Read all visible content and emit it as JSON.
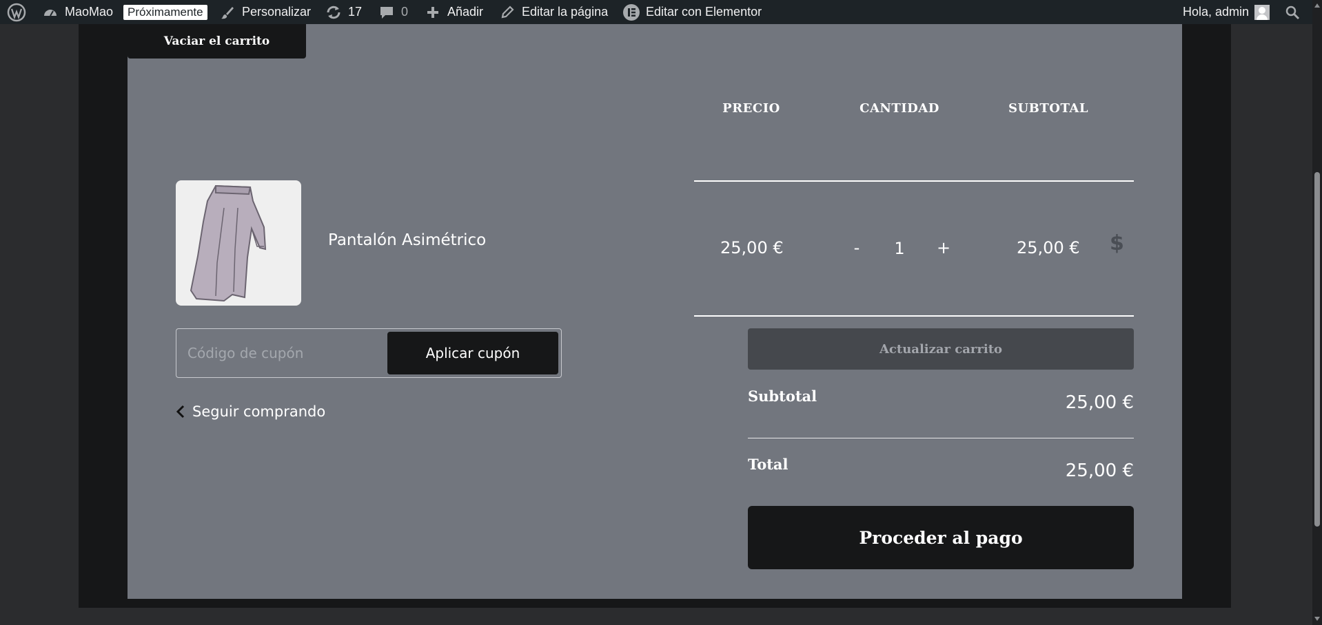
{
  "admin_bar": {
    "site_name": "MaoMao",
    "status_badge": "Próximamente",
    "customize": "Personalizar",
    "updates_count": "17",
    "comments_count": "0",
    "add_new": "Añadir",
    "edit_page": "Editar la página",
    "edit_elementor": "Editar con Elementor",
    "greeting": "Hola, admin"
  },
  "cart": {
    "empty_cart": "Vaciar el carrito",
    "headers": {
      "price": "PRECIO",
      "quantity": "CANTIDAD",
      "subtotal": "SUBTOTAL"
    },
    "item": {
      "name": "Pantalón Asimétrico",
      "price": "25,00 €",
      "quantity": "1",
      "minus": "-",
      "plus": "+",
      "subtotal": "25,00 €",
      "remove_icon": "$"
    },
    "coupon": {
      "placeholder": "Código de cupón",
      "apply": "Aplicar cupón"
    },
    "continue_shopping": "Seguir comprando",
    "update_cart": "Actualizar carrito"
  },
  "totals": {
    "subtotal_label": "Subtotal",
    "subtotal_value": "25,00 €",
    "total_label": "Total",
    "total_value": "25,00 €",
    "checkout": "Proceder al pago"
  }
}
